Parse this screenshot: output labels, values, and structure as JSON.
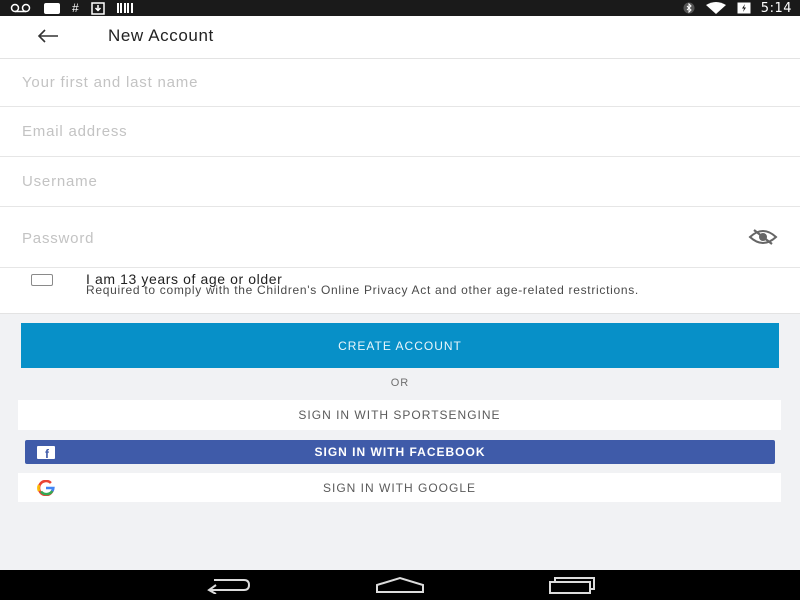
{
  "status_bar": {
    "time": "5:14",
    "hash_symbol": "#",
    "left_icons": [
      "voicemail-icon",
      "message-icon",
      "hash-icon",
      "download-icon",
      "barcode-icon"
    ],
    "right_icons": [
      "bluetooth-icon",
      "wifi-icon",
      "battery-icon"
    ]
  },
  "app_bar": {
    "title": "New Account",
    "back_icon": "arrow-left-icon"
  },
  "form": {
    "name_placeholder": "Your first and last name",
    "email_placeholder": "Email address",
    "username_placeholder": "Username",
    "password_placeholder": "Password",
    "password_toggle_icon": "eye-off-icon",
    "age_label": "I am 13 years of age or older",
    "age_help": "Required to comply with the Children's Online Privacy Act and other age-related restrictions.",
    "age_checked": false
  },
  "actions": {
    "create_label": "CREATE ACCOUNT",
    "or_label": "OR",
    "sportsengine_label": "SIGN IN WITH SPORTSENGINE",
    "facebook_label": "SIGN IN WITH FACEBOOK",
    "google_label": "SIGN IN WITH GOOGLE"
  },
  "colors": {
    "primary": "#0790c8",
    "facebook": "#3f5ba9",
    "background": "#f1f2f4"
  },
  "nav_bar": {
    "icons": [
      "back-icon",
      "home-icon",
      "recent-apps-icon"
    ]
  }
}
